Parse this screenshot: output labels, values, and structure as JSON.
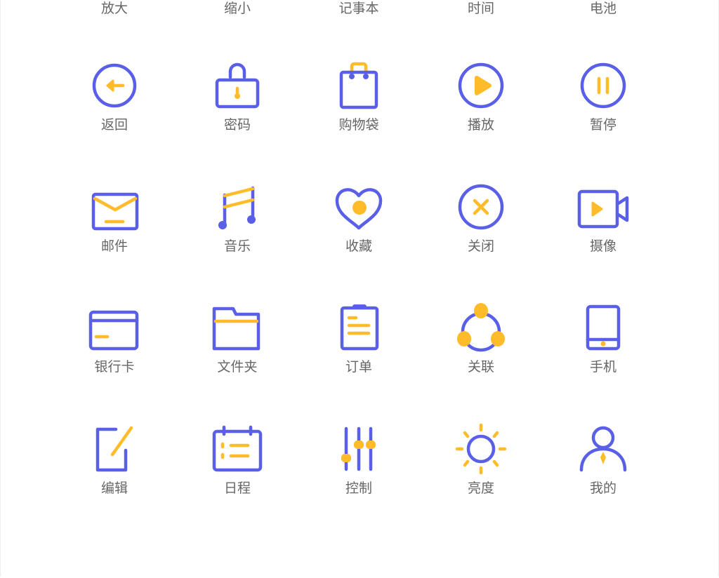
{
  "colors": {
    "primary": "#5a5fe8",
    "accent": "#ffbb2a",
    "label": "#666666"
  },
  "top_row": [
    "放大",
    "缩小",
    "记事本",
    "时间",
    "电池"
  ],
  "rows": [
    [
      {
        "icon": "back-icon",
        "label": "返回"
      },
      {
        "icon": "lock-icon",
        "label": "密码"
      },
      {
        "icon": "shopping-bag-icon",
        "label": "购物袋"
      },
      {
        "icon": "play-icon",
        "label": "播放"
      },
      {
        "icon": "pause-icon",
        "label": "暂停"
      }
    ],
    [
      {
        "icon": "mail-icon",
        "label": "邮件"
      },
      {
        "icon": "music-icon",
        "label": "音乐"
      },
      {
        "icon": "heart-icon",
        "label": "收藏"
      },
      {
        "icon": "close-icon",
        "label": "关闭"
      },
      {
        "icon": "camera-icon",
        "label": "摄像"
      }
    ],
    [
      {
        "icon": "bank-card-icon",
        "label": "银行卡"
      },
      {
        "icon": "folder-icon",
        "label": "文件夹"
      },
      {
        "icon": "order-icon",
        "label": "订单"
      },
      {
        "icon": "relation-icon",
        "label": "关联"
      },
      {
        "icon": "phone-icon",
        "label": "手机"
      }
    ],
    [
      {
        "icon": "edit-icon",
        "label": "编辑"
      },
      {
        "icon": "schedule-icon",
        "label": "日程"
      },
      {
        "icon": "control-icon",
        "label": "控制"
      },
      {
        "icon": "brightness-icon",
        "label": "亮度"
      },
      {
        "icon": "user-icon",
        "label": "我的"
      }
    ]
  ]
}
